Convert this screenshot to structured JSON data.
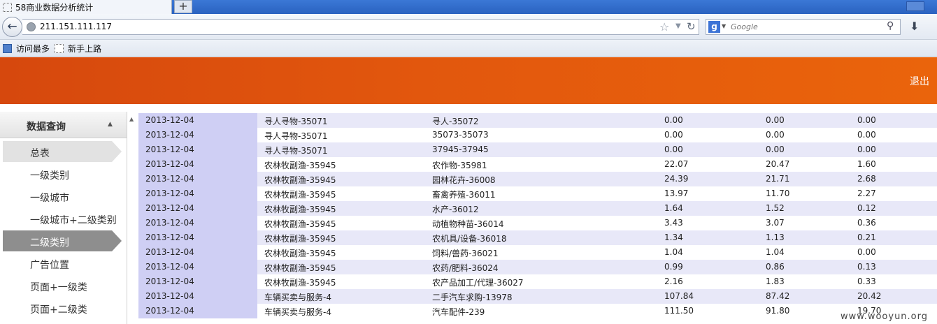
{
  "browser": {
    "tab_title": "58商业数据分析统计",
    "new_tab_symbol": "+",
    "url": "211.151.111.117",
    "search_placeholder": "Google",
    "search_engine_letter": "g",
    "bookmarks": [
      {
        "label": "访问最多",
        "icon": "most-visited-icon"
      },
      {
        "label": "新手上路",
        "icon": "page-icon"
      }
    ]
  },
  "header": {
    "logout_label": "退出"
  },
  "sidebar": {
    "title": "数据查询",
    "items": [
      {
        "label": "总表",
        "state": "hover"
      },
      {
        "label": "一级类别",
        "state": "normal"
      },
      {
        "label": "一级城市",
        "state": "normal"
      },
      {
        "label": "一级城市+二级类别",
        "state": "normal"
      },
      {
        "label": "二级类别",
        "state": "selected"
      },
      {
        "label": "广告位置",
        "state": "normal"
      },
      {
        "label": "页面+一级类",
        "state": "normal"
      },
      {
        "label": "页面+二级类",
        "state": "normal"
      }
    ]
  },
  "table": {
    "rows": [
      [
        "2013-12-04",
        "寻人寻物-35071",
        "寻人-35072",
        "0.00",
        "0.00",
        "0.00"
      ],
      [
        "2013-12-04",
        "寻人寻物-35071",
        "35073-35073",
        "0.00",
        "0.00",
        "0.00"
      ],
      [
        "2013-12-04",
        "寻人寻物-35071",
        "37945-37945",
        "0.00",
        "0.00",
        "0.00"
      ],
      [
        "2013-12-04",
        "农林牧副渔-35945",
        "农作物-35981",
        "22.07",
        "20.47",
        "1.60"
      ],
      [
        "2013-12-04",
        "农林牧副渔-35945",
        "园林花卉-36008",
        "24.39",
        "21.71",
        "2.68"
      ],
      [
        "2013-12-04",
        "农林牧副渔-35945",
        "畜禽养殖-36011",
        "13.97",
        "11.70",
        "2.27"
      ],
      [
        "2013-12-04",
        "农林牧副渔-35945",
        "水产-36012",
        "1.64",
        "1.52",
        "0.12"
      ],
      [
        "2013-12-04",
        "农林牧副渔-35945",
        "动植物种苗-36014",
        "3.43",
        "3.07",
        "0.36"
      ],
      [
        "2013-12-04",
        "农林牧副渔-35945",
        "农机具/设备-36018",
        "1.34",
        "1.13",
        "0.21"
      ],
      [
        "2013-12-04",
        "农林牧副渔-35945",
        "饲料/兽药-36021",
        "1.04",
        "1.04",
        "0.00"
      ],
      [
        "2013-12-04",
        "农林牧副渔-35945",
        "农药/肥料-36024",
        "0.99",
        "0.86",
        "0.13"
      ],
      [
        "2013-12-04",
        "农林牧副渔-35945",
        "农产品加工/代理-36027",
        "2.16",
        "1.83",
        "0.33"
      ],
      [
        "2013-12-04",
        "车辆买卖与服务-4",
        "二手汽车求购-13978",
        "107.84",
        "87.42",
        "20.42"
      ],
      [
        "2013-12-04",
        "车辆买卖与服务-4",
        "汽车配件-239",
        "111.50",
        "91.80",
        "19.70"
      ]
    ]
  },
  "watermark": "www.wooyun.org"
}
